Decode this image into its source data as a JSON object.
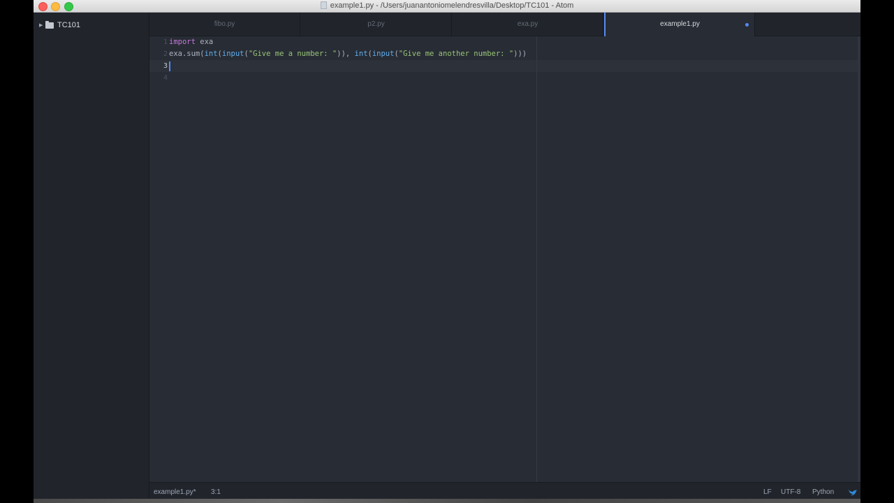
{
  "window": {
    "title": "example1.py - /Users/juanantoniomelendresvilla/Desktop/TC101 - Atom"
  },
  "tree": {
    "root_label": "TC101"
  },
  "tabs": [
    {
      "label": "fibo.py",
      "active": false
    },
    {
      "label": "p2.py",
      "active": false
    },
    {
      "label": "exa.py",
      "active": false
    },
    {
      "label": "example1.py",
      "active": true,
      "modified": true
    }
  ],
  "editor": {
    "line_numbers": [
      "1",
      "2",
      "3",
      "4"
    ],
    "current_line": 3,
    "lines": {
      "l1": {
        "keyword": "import",
        "rest": " exa"
      },
      "l2": {
        "p1": "exa.sum(",
        "f1": "int",
        "p2": "(",
        "f2": "input",
        "p3": "(",
        "s1": "\"Give me a number: \"",
        "p4": ")), ",
        "f3": "int",
        "p5": "(",
        "f4": "input",
        "p6": "(",
        "s2": "\"Give me another number: \"",
        "p7": ")))"
      }
    }
  },
  "status": {
    "file": "example1.py*",
    "cursor": "3:1",
    "line_ending": "LF",
    "encoding": "UTF-8",
    "grammar": "Python"
  },
  "colors": {
    "accent": "#568af2",
    "keyword": "#c678dd",
    "function": "#61afef",
    "string": "#98c379",
    "editor_bg": "#282c34"
  }
}
